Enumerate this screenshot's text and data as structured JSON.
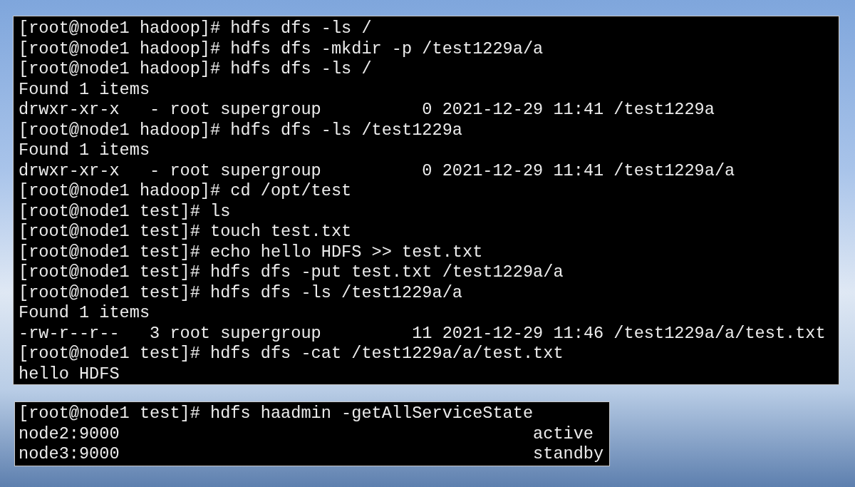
{
  "terminal_main": {
    "lines": [
      "[root@node1 hadoop]# hdfs dfs -ls /",
      "[root@node1 hadoop]# hdfs dfs -mkdir -p /test1229a/a",
      "[root@node1 hadoop]# hdfs dfs -ls /",
      "Found 1 items",
      "drwxr-xr-x   - root supergroup          0 2021-12-29 11:41 /test1229a",
      "[root@node1 hadoop]# hdfs dfs -ls /test1229a",
      "Found 1 items",
      "drwxr-xr-x   - root supergroup          0 2021-12-29 11:41 /test1229a/a",
      "[root@node1 hadoop]# cd /opt/test",
      "[root@node1 test]# ls",
      "[root@node1 test]# touch test.txt",
      "[root@node1 test]# echo hello HDFS >> test.txt",
      "[root@node1 test]# hdfs dfs -put test.txt /test1229a/a",
      "[root@node1 test]# hdfs dfs -ls /test1229a/a",
      "Found 1 items",
      "-rw-r--r--   3 root supergroup         11 2021-12-29 11:46 /test1229a/a/test.txt",
      "[root@node1 test]# hdfs dfs -cat /test1229a/a/test.txt",
      "hello HDFS"
    ]
  },
  "terminal_ha": {
    "command": "[root@node1 test]# hdfs haadmin -getAllServiceState",
    "rows": [
      {
        "host": "node2:9000",
        "state": "active"
      },
      {
        "host": "node3:9000",
        "state": "standby"
      }
    ]
  }
}
